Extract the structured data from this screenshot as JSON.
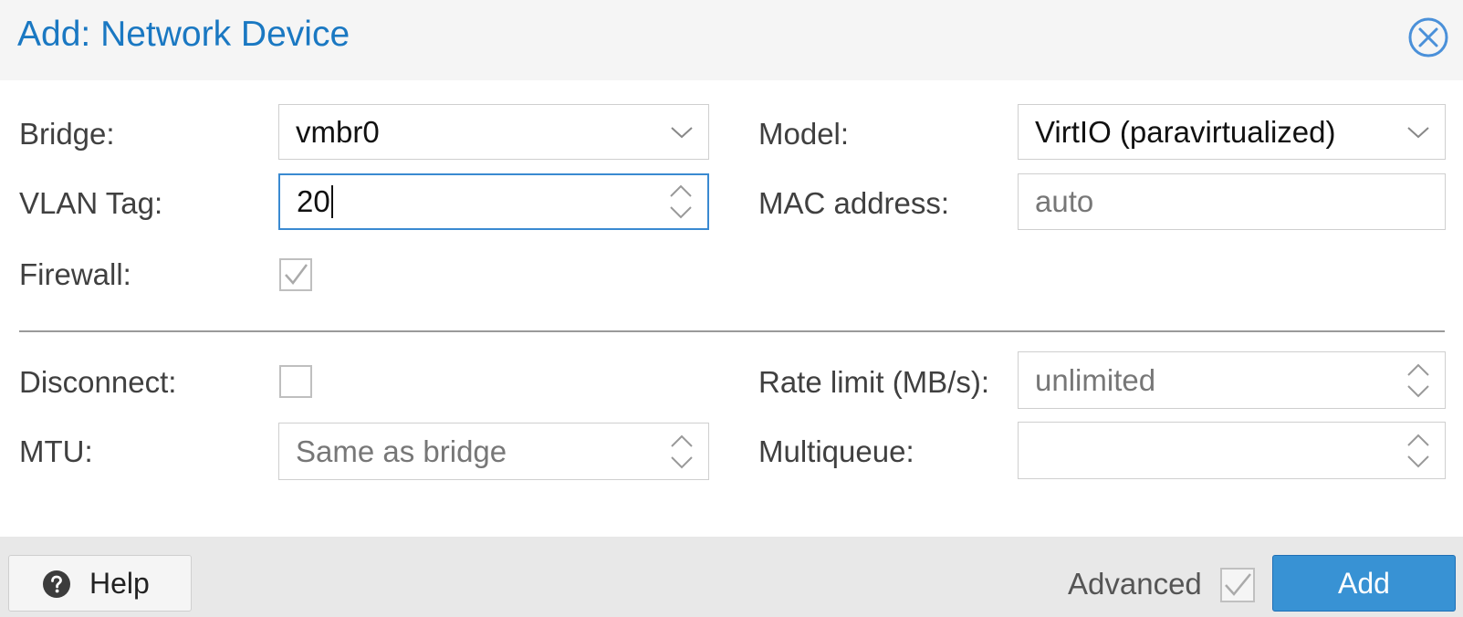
{
  "dialog": {
    "title": "Add: Network Device"
  },
  "fields": {
    "bridge": {
      "label": "Bridge:",
      "value": "vmbr0"
    },
    "model": {
      "label": "Model:",
      "value": "VirtIO (paravirtualized)"
    },
    "vlan_tag": {
      "label": "VLAN Tag:",
      "value": "20"
    },
    "mac_address": {
      "label": "MAC address:",
      "placeholder": "auto"
    },
    "firewall": {
      "label": "Firewall:",
      "checked": true
    },
    "disconnect": {
      "label": "Disconnect:",
      "checked": false
    },
    "rate_limit": {
      "label": "Rate limit (MB/s):",
      "placeholder": "unlimited"
    },
    "mtu": {
      "label": "MTU:",
      "placeholder": "Same as bridge"
    },
    "multiqueue": {
      "label": "Multiqueue:",
      "placeholder": ""
    }
  },
  "footer": {
    "help_label": "Help",
    "advanced_label": "Advanced",
    "advanced_checked": true,
    "add_label": "Add"
  },
  "colors": {
    "accent": "#1a78c2",
    "primary_button": "#3892d4",
    "focus_border": "#3a8ad1"
  },
  "icons": {
    "close": "close-circle-icon",
    "dropdown": "chevron-down-icon",
    "spinner": "spinner-arrows-icon",
    "help": "question-circle-icon",
    "check": "checkmark-icon"
  }
}
